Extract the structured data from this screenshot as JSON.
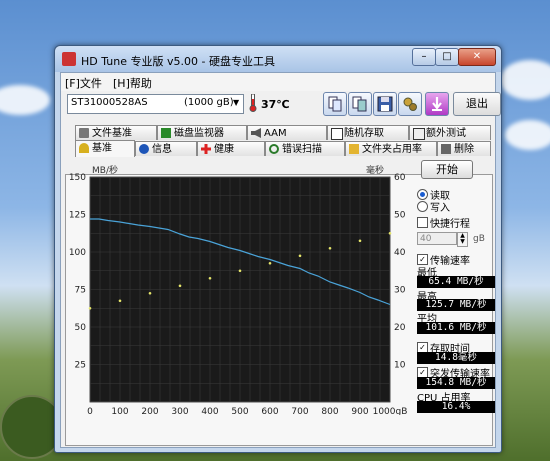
{
  "window": {
    "title": "HD Tune 专业版 v5.00 - 硬盘专业工具"
  },
  "menu": [
    {
      "label": "[F]文件"
    },
    {
      "label": "[H]帮助"
    }
  ],
  "toolbar": {
    "drive": "ST31000528AS",
    "capacity": "(1000 gB)",
    "temperature": "37℃",
    "exit_label": "退出"
  },
  "tabs_top": [
    "文件基准",
    "磁盘监视器",
    "AAM",
    "随机存取",
    "额外测试"
  ],
  "tabs_bottom": [
    "基准",
    "信息",
    "健康",
    "错误扫描",
    "文件夹占用率",
    "删除"
  ],
  "controls": {
    "start_label": "开始",
    "read_label": "读取",
    "write_label": "写入",
    "short_stroke_label": "快捷行程",
    "short_stroke_value": "40",
    "short_stroke_unit": "gB",
    "transfer_rate_label": "传输速率",
    "min_label": "最低",
    "min_value": "65.4 MB/秒",
    "max_label": "最高",
    "max_value": "125.7 MB/秒",
    "avg_label": "平均",
    "avg_value": "101.6 MB/秒",
    "access_time_label": "存取时间",
    "access_time_value": "14.8毫秒",
    "burst_label": "突发传输速率",
    "burst_value": "154.8 MB/秒",
    "cpu_label": "CPU 占用率",
    "cpu_value": "16.4%"
  },
  "chart_data": {
    "type": "line",
    "ylabel": "MB/秒",
    "y2label": "毫秒",
    "yticks": [
      "150",
      "125",
      "100",
      "75",
      "50",
      "25"
    ],
    "y2ticks": [
      "60",
      "50",
      "40",
      "30",
      "20",
      "10"
    ],
    "xticks": [
      "0",
      "100",
      "200",
      "300",
      "400",
      "500",
      "600",
      "700",
      "800",
      "900",
      "1000gB"
    ],
    "xlim": [
      0,
      1000
    ],
    "ylim": [
      0,
      150
    ],
    "y2lim": [
      0,
      60
    ],
    "grid": true,
    "series": [
      {
        "name": "传输速率",
        "x": [
          0,
          30,
          60,
          100,
          130,
          160,
          200,
          230,
          260,
          300,
          330,
          360,
          400,
          430,
          460,
          500,
          530,
          560,
          600,
          630,
          660,
          700,
          730,
          760,
          800,
          830,
          860,
          900,
          930,
          960,
          1000
        ],
        "y": [
          122,
          122,
          121,
          120,
          119,
          118,
          117,
          116,
          115,
          112,
          110,
          109,
          107,
          105,
          103,
          101,
          99,
          97,
          95,
          93,
          91,
          89,
          86,
          84,
          80,
          78,
          76,
          73,
          70,
          68,
          65
        ],
        "color": "#4aa3d8"
      },
      {
        "name": "存取时间",
        "x": [
          0,
          100,
          200,
          300,
          400,
          500,
          600,
          700,
          800,
          900,
          1000
        ],
        "y": [
          25,
          27,
          29,
          31,
          33,
          35,
          37,
          39,
          41,
          43,
          45
        ],
        "color": "#e5e56a"
      }
    ]
  }
}
